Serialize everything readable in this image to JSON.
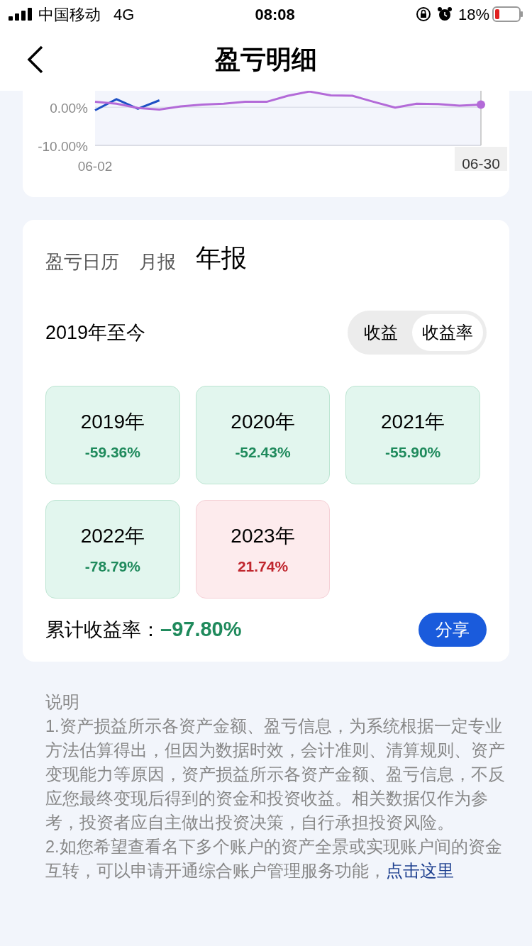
{
  "status_bar": {
    "carrier": "中国移动",
    "network": "4G",
    "time": "08:08",
    "battery": "18%"
  },
  "nav": {
    "title": "盈亏明细"
  },
  "trend_card": {
    "chart_data": {
      "type": "line",
      "categories": [
        "06-02",
        null,
        null,
        null,
        null,
        null,
        null,
        null,
        null,
        null,
        null,
        null,
        null,
        null,
        null,
        null,
        null,
        null,
        "06-30"
      ],
      "ylim": [
        -10,
        4.3
      ],
      "yticks": [
        {
          "value": 0,
          "label": "0.00%"
        },
        {
          "value": -10,
          "label": "-10.00%"
        }
      ],
      "series": [
        {
          "color": "#1d4fc4",
          "values": [
            -0.8,
            2.1,
            -0.4,
            1.8,
            null,
            null,
            null,
            null,
            null,
            null,
            null,
            null,
            null,
            null,
            null,
            null,
            null,
            null,
            null
          ]
        },
        {
          "color": "#b36ad8",
          "values": [
            1.4,
            0.9,
            -0.2,
            -0.6,
            0.2,
            0.7,
            0.9,
            1.4,
            1.4,
            3.0,
            4.1,
            3.1,
            3.0,
            1.4,
            -0.1,
            0.9,
            0.8,
            0.4,
            0.7
          ]
        }
      ]
    }
  },
  "report_card": {
    "tabs": [
      {
        "label": "盈亏日历",
        "selected": false
      },
      {
        "label": "月报",
        "selected": false
      },
      {
        "label": "年报",
        "selected": true
      }
    ],
    "period": "2019年至今",
    "toggle": [
      {
        "label": "收益",
        "selected": false
      },
      {
        "label": "收益率",
        "selected": true
      }
    ],
    "years": [
      {
        "year": "2019年",
        "rate": "-59.36%",
        "kind": "loss"
      },
      {
        "year": "2020年",
        "rate": "-52.43%",
        "kind": "loss"
      },
      {
        "year": "2021年",
        "rate": "-55.90%",
        "kind": "loss"
      },
      {
        "year": "2022年",
        "rate": "-78.79%",
        "kind": "loss"
      },
      {
        "year": "2023年",
        "rate": "21.74%",
        "kind": "gain"
      }
    ],
    "total": {
      "label": "累计收益率：",
      "value": "–97.80%",
      "kind": "loss"
    },
    "share": "分享"
  },
  "notes": {
    "title": "说明",
    "items": [
      "1.资产损益所示各资产金额、盈亏信息，为系统根据一定专业方法估算得出，但因为数据时效，会计准则、清算规则、资产变现能力等原因，资产损益所示各资产金额、盈亏信息，不反应您最终变现后得到的资金和投资收益。相关数据仅作为参考，投资者应自主做出投资决策，自行承担投资风险。",
      "2.如您希望查看名下多个账户的资产全景或实现账户间的资金互转，可以申请开通综合账户管理服务功能，"
    ],
    "link": "点击这里"
  }
}
